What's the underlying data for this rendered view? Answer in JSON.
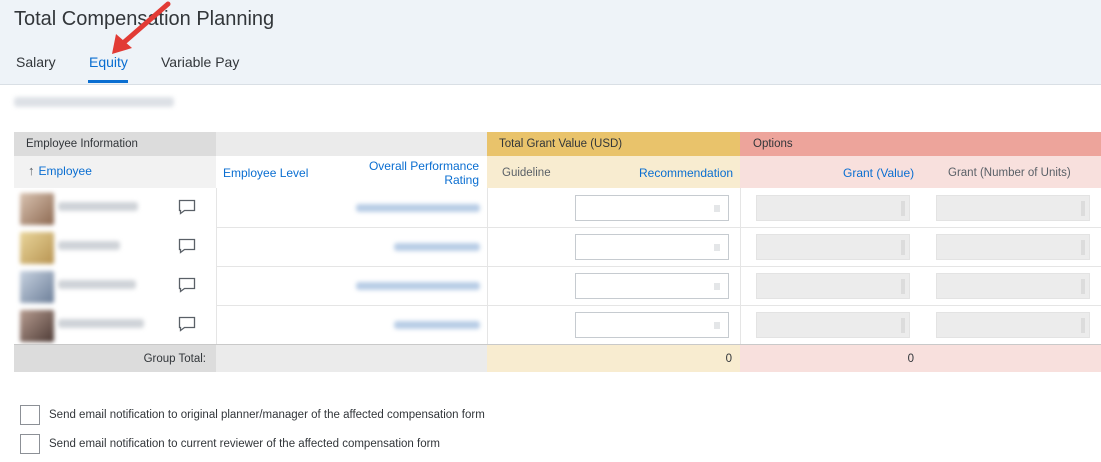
{
  "page": {
    "title": "Total Compensation Planning",
    "tabs": [
      {
        "label": "Salary"
      },
      {
        "label": "Equity",
        "active": true
      },
      {
        "label": "Variable Pay"
      }
    ]
  },
  "table": {
    "group_headers": {
      "employee_information": "Employee Information",
      "total_grant_value": "Total Grant Value (USD)",
      "options": "Options"
    },
    "columns": {
      "employee": "Employee",
      "employee_level": "Employee Level",
      "overall_performance_rating": "Overall Performance Rating",
      "guideline": "Guideline",
      "recommendation": "Recommendation",
      "grant_value": "Grant (Value)",
      "grant_units": "Grant (Number of Units)"
    },
    "group_total": {
      "label": "Group Total:",
      "recommendation_total": "0",
      "grant_value_total": "0"
    }
  },
  "notifications": [
    {
      "label": "Send email notification to original planner/manager of the affected compensation form",
      "checked": false
    },
    {
      "label": "Send email notification to current reviewer of the affected compensation form",
      "checked": false
    }
  ],
  "colors": {
    "accent": "#0a6ed1",
    "grant_header": "#e9c36b",
    "grant_subheader": "#f8ecd0",
    "options_header": "#eda49b",
    "options_subheader": "#f8e0dd"
  }
}
